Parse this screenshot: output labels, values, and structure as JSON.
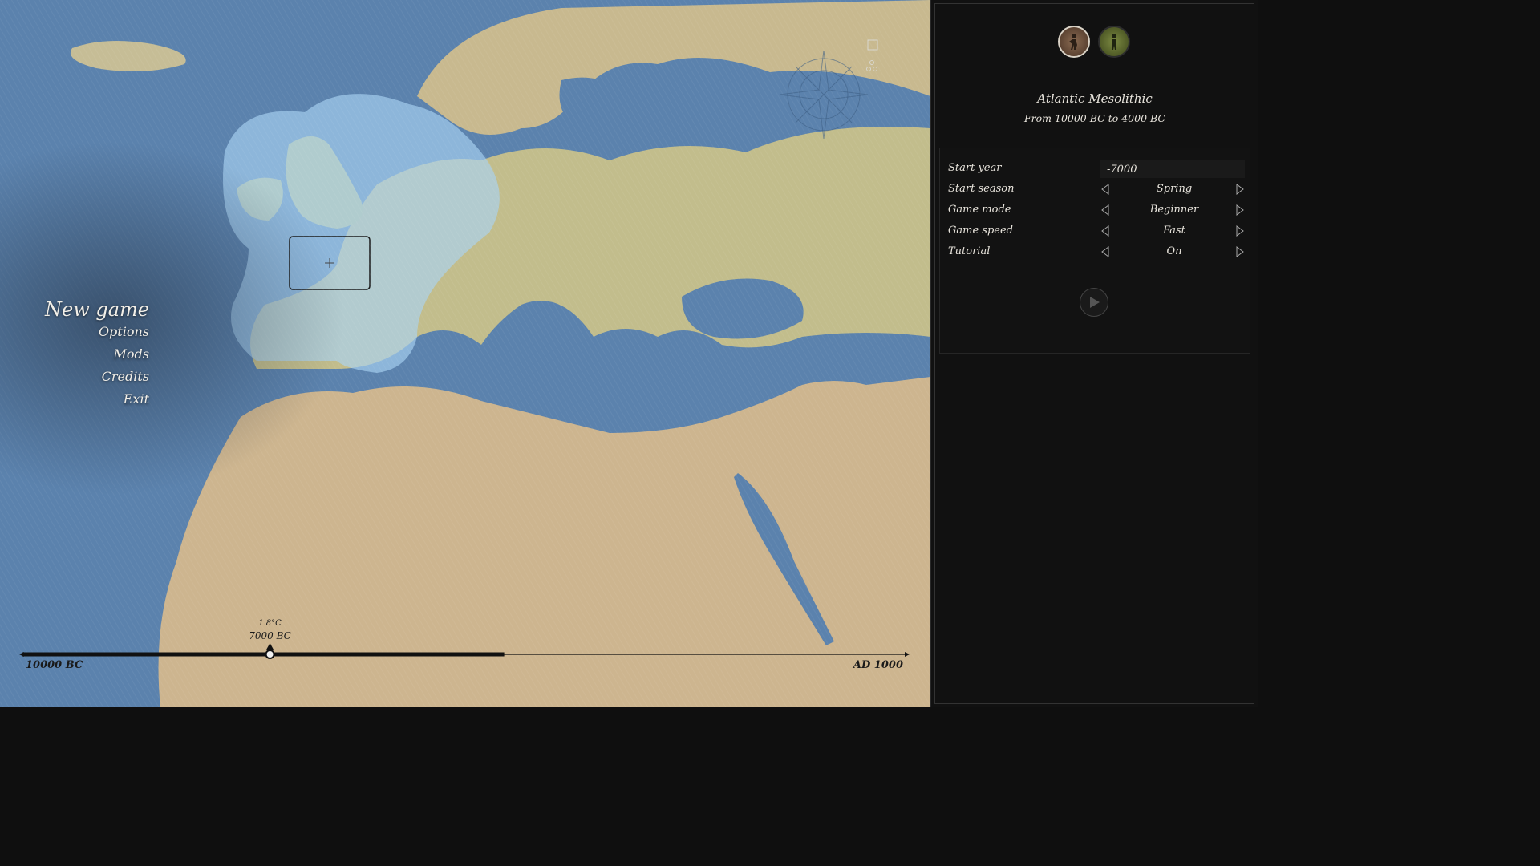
{
  "menu": {
    "new_game": "New game",
    "options": "Options",
    "mods": "Mods",
    "credits": "Credits",
    "exit": "Exit"
  },
  "timeline": {
    "start_label": "10000 BC",
    "end_label": "AD 1000",
    "temperature": "1.8°C",
    "current_year": "7000 BC",
    "progress": 0.28,
    "available_fraction": 0.545
  },
  "culture": {
    "title": "Atlantic Mesolithic",
    "range": "From 10000 BC to 4000 BC",
    "icons": [
      "hunter-culture-icon",
      "gatherer-culture-icon"
    ]
  },
  "settings": {
    "start_year_label": "Start year",
    "start_year_value": "-7000",
    "start_season_label": "Start season",
    "start_season_value": "Spring",
    "game_mode_label": "Game mode",
    "game_mode_value": "Beginner",
    "game_speed_label": "Game speed",
    "game_speed_value": "Fast",
    "tutorial_label": "Tutorial",
    "tutorial_value": "On"
  },
  "colors": {
    "ocean": "#5b82ad",
    "land": "#c9b48a",
    "highlight": "#9dc6ea",
    "panel": "#111111"
  }
}
